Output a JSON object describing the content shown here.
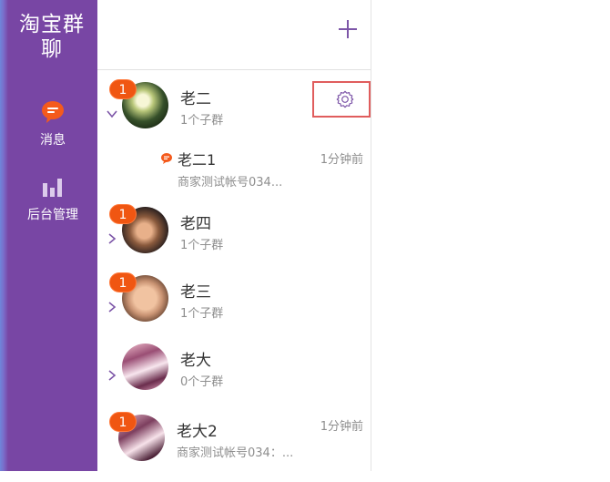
{
  "sidebar": {
    "logo": "淘宝群聊",
    "items": [
      {
        "label": "消息",
        "icon": "chat-bubble-icon"
      },
      {
        "label": "后台管理",
        "icon": "bar-chart-icon"
      }
    ]
  },
  "panel": {
    "add_icon": "plus-icon",
    "groups": [
      {
        "title": "老二",
        "sub": "1个子群",
        "badge": "1",
        "time": "",
        "expanded": true
      },
      {
        "title": "老四",
        "sub": "1个子群",
        "badge": "1",
        "time": "",
        "expanded": false
      },
      {
        "title": "老三",
        "sub": "1个子群",
        "badge": "1",
        "time": "",
        "expanded": false
      },
      {
        "title": "老大",
        "sub": "0个子群",
        "badge": "",
        "time": "",
        "expanded": false
      },
      {
        "title": "老大2",
        "sub": "商家测试帐号034：...",
        "badge": "1",
        "time": "1分钟前",
        "expanded": false
      }
    ],
    "subgroup": {
      "title": "老二1",
      "sub": "商家测试帐号034...",
      "time": "1分钟前"
    }
  },
  "colors": {
    "sidebar": "#7846a4",
    "accent": "#7d56a8",
    "badge": "#f05612",
    "highlight_border": "#e05d5d"
  }
}
